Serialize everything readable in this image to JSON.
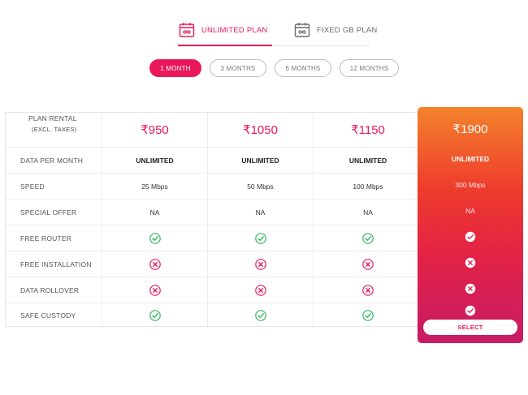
{
  "plan_tabs": [
    {
      "label": "UNLIMITED PLAN",
      "icon": "calendar-infinity-icon",
      "active": true
    },
    {
      "label": "FIXED GB PLAN",
      "icon": "calendar-infinity-icon",
      "active": false
    }
  ],
  "durations": [
    {
      "label": "1 MONTH",
      "active": true
    },
    {
      "label": "3 MONTHS",
      "active": false
    },
    {
      "label": "6 MONTHS",
      "active": false
    },
    {
      "label": "12 MONTHS",
      "active": false
    }
  ],
  "row_labels": {
    "rental": "PLAN RENTAL",
    "rental_sub": "(EXCL. TAXES)",
    "data": "DATA PER MONTH",
    "speed": "SPEED",
    "offer": "SPECIAL OFFER",
    "router": "FREE ROUTER",
    "installation": "FREE INSTALLATION",
    "rollover": "DATA ROLLOVER",
    "custody": "SAFE CUSTODY"
  },
  "plans": [
    {
      "price": "₹950",
      "data": "UNLIMITED",
      "speed": "25 Mbps",
      "offer": "NA",
      "router": "yes",
      "installation": "no",
      "rollover": "no",
      "custody": "yes"
    },
    {
      "price": "₹1050",
      "data": "UNLIMITED",
      "speed": "50 Mbps",
      "offer": "NA",
      "router": "yes",
      "installation": "no",
      "rollover": "no",
      "custody": "yes"
    },
    {
      "price": "₹1150",
      "data": "UNLIMITED",
      "speed": "100 Mbps",
      "offer": "NA",
      "router": "yes",
      "installation": "no",
      "rollover": "no",
      "custody": "yes"
    },
    {
      "price": "₹1900",
      "data": "UNLIMITED",
      "speed": "300 Mbps",
      "offer": "NA",
      "router": "yes",
      "installation": "no",
      "rollover": "no",
      "custody": "yes",
      "featured": true
    }
  ],
  "select_label": "SELECT",
  "colors": {
    "accent": "#e8185b",
    "check": "#2db55d",
    "cross": "#e8185b",
    "featured_top": "#f3832b",
    "featured_bottom": "#c61b66"
  }
}
